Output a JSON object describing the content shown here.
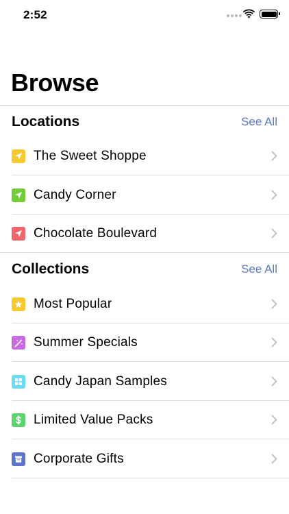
{
  "status_bar": {
    "time": "2:52"
  },
  "page": {
    "title": "Browse"
  },
  "locations": {
    "title": "Locations",
    "see_all": "See All",
    "items": [
      {
        "label": "The Sweet Shoppe",
        "icon": "location-arrow-icon",
        "color": "#f8c930"
      },
      {
        "label": "Candy Corner",
        "icon": "location-arrow-icon",
        "color": "#71cc37"
      },
      {
        "label": "Chocolate Boulevard",
        "icon": "location-arrow-icon",
        "color": "#f0666c"
      }
    ]
  },
  "collections": {
    "title": "Collections",
    "see_all": "See All",
    "items": [
      {
        "label": "Most Popular",
        "icon": "star-icon",
        "color": "#f8c930"
      },
      {
        "label": "Summer Specials",
        "icon": "magic-wand-icon",
        "color": "#c66be0"
      },
      {
        "label": "Candy Japan Samples",
        "icon": "grid-icon",
        "color": "#6ddbf4"
      },
      {
        "label": "Limited Value Packs",
        "icon": "dollar-icon",
        "color": "#5bd46d"
      },
      {
        "label": "Corporate Gifts",
        "icon": "archive-box-icon",
        "color": "#5e74cc"
      }
    ]
  }
}
